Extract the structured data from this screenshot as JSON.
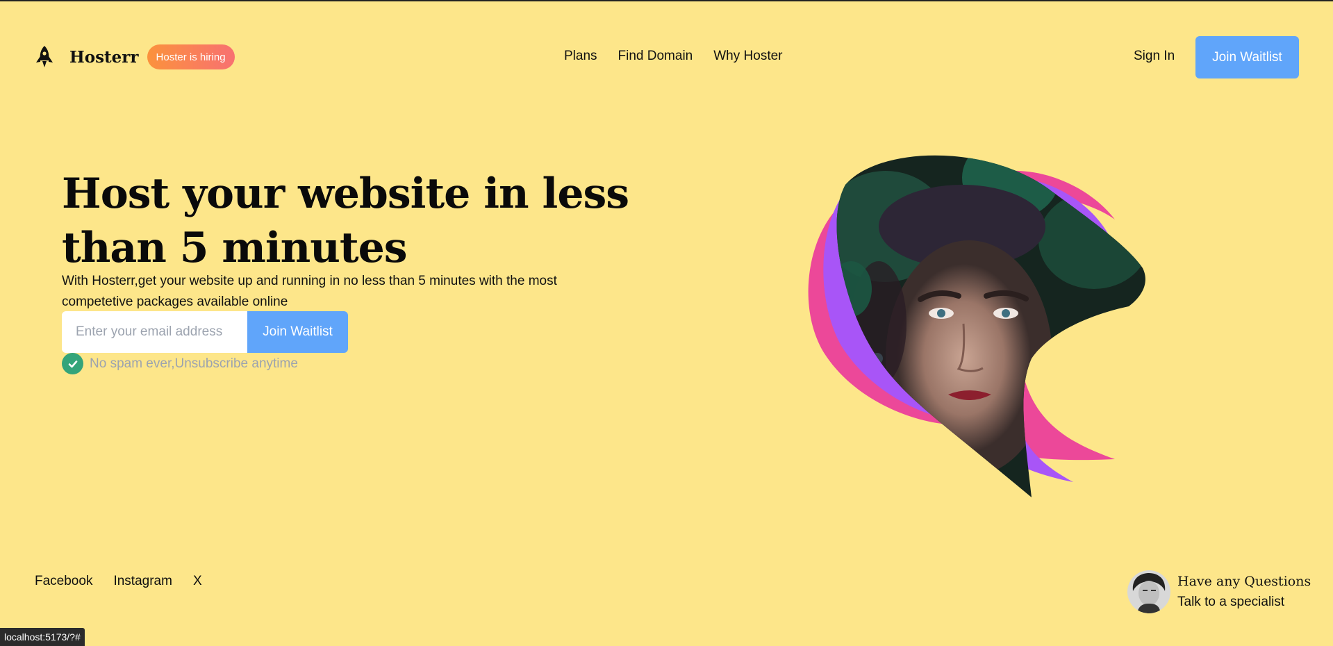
{
  "header": {
    "logo_icon": "rocket-icon",
    "brand_name": "Hosterr",
    "hiring_badge": "Hoster is hiring",
    "nav": [
      "Plans",
      "Find Domain",
      "Why Hoster"
    ],
    "sign_in": "Sign In",
    "join_waitlist": "Join Waitlist"
  },
  "hero": {
    "title": "Host your website in less than 5 minutes",
    "subtitle": "With Hosterr,get your website up and running in no less than 5 minutes with the most competetive packages available online",
    "email_placeholder": "Enter your email address",
    "join_waitlist": "Join Waitlist",
    "no_spam": "No spam ever,Unsubscribe anytime"
  },
  "footer": {
    "social": [
      "Facebook",
      "Instagram",
      "X"
    ],
    "help_question": "Have any Questions",
    "help_link": "Talk to a specialist"
  },
  "status_url": "localhost:5173/?#",
  "colors": {
    "background": "#fde68a",
    "accent": "#60a5fa",
    "badge_from": "#fb923c",
    "badge_to": "#f87171",
    "check": "#34a47a",
    "shape_pink": "#ec4899",
    "shape_purple": "#a855f7"
  }
}
